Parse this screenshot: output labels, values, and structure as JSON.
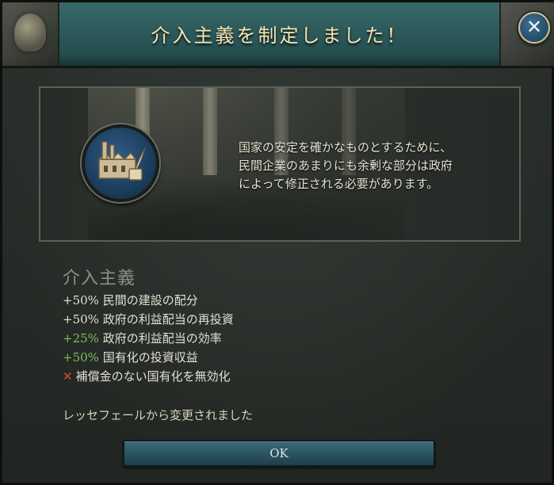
{
  "dialog": {
    "title": "介入主義を制定しました！",
    "close_symbol": "✕"
  },
  "flavor": {
    "lines": [
      "国家の安定を確かなものとするために、",
      "民間企業のあまりにも余剰な部分は政府",
      "によって修正される必要があります。"
    ]
  },
  "ideology": {
    "name": "介入主義",
    "icon": "factory-quill-icon"
  },
  "effects": [
    {
      "pct": "+50%",
      "text": "民間の建設の配分",
      "positive_color": false
    },
    {
      "pct": "+50%",
      "text": "政府の利益配当の再投資",
      "positive_color": false
    },
    {
      "pct": "+25%",
      "text": "政府の利益配当の効率",
      "positive_color": true
    },
    {
      "pct": "+50%",
      "text": "国有化の投資収益",
      "positive_color": true
    }
  ],
  "disabled_effect": {
    "icon": "✕",
    "text": "補償金のない国有化を無効化"
  },
  "change_note": "レッセフェールから変更されました",
  "ok_button": {
    "label": "OK"
  },
  "colors": {
    "header": "#2d5a5b",
    "title_text": "#f4e6b4",
    "positive": "#7fbf5a",
    "negative": "#d04a3a",
    "emblem": "#2f5d86"
  }
}
